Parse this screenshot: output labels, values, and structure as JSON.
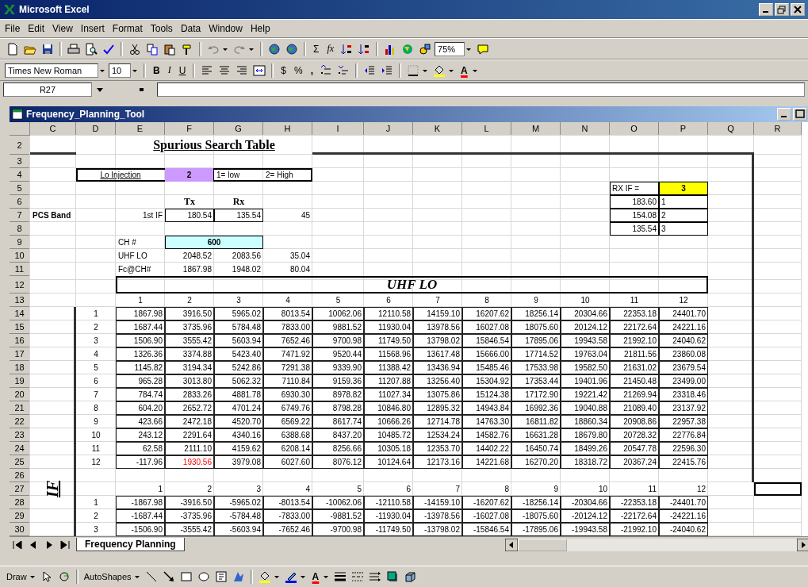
{
  "app": {
    "title": "Microsoft Excel"
  },
  "menu": [
    "File",
    "Edit",
    "View",
    "Insert",
    "Format",
    "Tools",
    "Data",
    "Window",
    "Help"
  ],
  "standard_toolbar": {
    "sum": "Σ",
    "function": "fx",
    "zoom": "75%"
  },
  "formatting_toolbar": {
    "font": "Times New Roman",
    "size": "10",
    "bold": "B",
    "italic": "I",
    "underline": "U",
    "currency": "$",
    "percent": "%",
    "comma": ",",
    "font_color": "A"
  },
  "formula_bar": {
    "name_box": "R27"
  },
  "workbook": {
    "title": "Frequency_Planning_Tool",
    "sheet": {
      "columns": [
        "C",
        "D",
        "E",
        "F",
        "G",
        "H",
        "I",
        "J",
        "K",
        "L",
        "M",
        "N",
        "O",
        "P",
        "Q",
        "R"
      ],
      "rows": [
        "2",
        "3",
        "4",
        "5",
        "6",
        "7",
        "8",
        "9",
        "10",
        "11",
        "12",
        "13",
        "14",
        "15",
        "16",
        "17",
        "18",
        "19",
        "20",
        "21",
        "22",
        "23",
        "24",
        "25",
        "26",
        "27",
        "28",
        "29",
        "30"
      ],
      "title": "Spurious Search Table",
      "lo_injection": {
        "label": "Lo Injection",
        "value": "2",
        "color": "#cc99ff",
        "options": [
          "1= low",
          "2= High"
        ]
      },
      "headers": [
        "Tx",
        "Rx"
      ],
      "band": "PCS Band",
      "params": [
        {
          "label": "1st IF",
          "tx": "180.54",
          "rx": "135.54",
          "diff": "45",
          "boxed": true
        },
        {
          "label": "UHF LO",
          "tx": "2048.52",
          "rx": "2083.56",
          "diff": "35.04",
          "boxed": false
        },
        {
          "label": "Fc@CH#",
          "tx": "1867.98",
          "rx": "1948.02",
          "diff": "80.04",
          "boxed": false
        }
      ],
      "channel": {
        "label": "CH #",
        "value": "600",
        "color": "#ccffff"
      },
      "rx_if": {
        "label": "RX IF =",
        "value": "3",
        "color": "#ffff00",
        "options": [
          {
            "freq": "183.60",
            "n": "1"
          },
          {
            "freq": "154.08",
            "n": "2"
          },
          {
            "freq": "135.54",
            "n": "3"
          }
        ]
      },
      "uhf_table": {
        "title": "UHF LO",
        "headers": [
          "1",
          "2",
          "3",
          "4",
          "5",
          "6",
          "7",
          "8",
          "9",
          "10",
          "11",
          "12"
        ],
        "rows": [
          {
            "n": "1",
            "values": [
              "1867.98",
              "3916.50",
              "5965.02",
              "8013.54",
              "10062.06",
              "12110.58",
              "14159.10",
              "16207.62",
              "18256.14",
              "20304.66",
              "22353.18",
              "24401.70"
            ],
            "flagged": [
              false,
              false,
              false,
              false,
              false,
              false,
              false,
              false,
              false,
              false,
              false,
              false
            ]
          },
          {
            "n": "2",
            "values": [
              "1687.44",
              "3735.96",
              "5784.48",
              "7833.00",
              "9881.52",
              "11930.04",
              "13978.56",
              "16027.08",
              "18075.60",
              "20124.12",
              "22172.64",
              "24221.16"
            ],
            "flagged": [
              false,
              false,
              false,
              false,
              false,
              false,
              false,
              false,
              false,
              false,
              false,
              false
            ]
          },
          {
            "n": "3",
            "values": [
              "1506.90",
              "3555.42",
              "5603.94",
              "7652.46",
              "9700.98",
              "11749.50",
              "13798.02",
              "15846.54",
              "17895.06",
              "19943.58",
              "21992.10",
              "24040.62"
            ],
            "flagged": [
              false,
              false,
              false,
              false,
              false,
              false,
              false,
              false,
              false,
              false,
              false,
              false
            ]
          },
          {
            "n": "4",
            "values": [
              "1326.36",
              "3374.88",
              "5423.40",
              "7471.92",
              "9520.44",
              "11568.96",
              "13617.48",
              "15666.00",
              "17714.52",
              "19763.04",
              "21811.56",
              "23860.08"
            ],
            "flagged": [
              false,
              false,
              false,
              false,
              false,
              false,
              false,
              false,
              false,
              false,
              false,
              false
            ]
          },
          {
            "n": "5",
            "values": [
              "1145.82",
              "3194.34",
              "5242.86",
              "7291.38",
              "9339.90",
              "11388.42",
              "13436.94",
              "15485.46",
              "17533.98",
              "19582.50",
              "21631.02",
              "23679.54"
            ],
            "flagged": [
              false,
              false,
              false,
              false,
              false,
              false,
              false,
              false,
              false,
              false,
              false,
              false
            ]
          },
          {
            "n": "6",
            "values": [
              "965.28",
              "3013.80",
              "5062.32",
              "7110.84",
              "9159.36",
              "11207.88",
              "13256.40",
              "15304.92",
              "17353.44",
              "19401.96",
              "21450.48",
              "23499.00"
            ],
            "flagged": [
              false,
              false,
              false,
              false,
              false,
              false,
              false,
              false,
              false,
              false,
              false,
              false
            ]
          },
          {
            "n": "7",
            "values": [
              "784.74",
              "2833.26",
              "4881.78",
              "6930.30",
              "8978.82",
              "11027.34",
              "13075.86",
              "15124.38",
              "17172.90",
              "19221.42",
              "21269.94",
              "23318.46"
            ],
            "flagged": [
              false,
              false,
              false,
              false,
              false,
              false,
              false,
              false,
              false,
              false,
              false,
              false
            ]
          },
          {
            "n": "8",
            "values": [
              "604.20",
              "2652.72",
              "4701.24",
              "6749.76",
              "8798.28",
              "10846.80",
              "12895.32",
              "14943.84",
              "16992.36",
              "19040.88",
              "21089.40",
              "23137.92"
            ],
            "flagged": [
              false,
              false,
              false,
              false,
              false,
              false,
              false,
              false,
              false,
              false,
              false,
              false
            ]
          },
          {
            "n": "9",
            "values": [
              "423.66",
              "2472.18",
              "4520.70",
              "6569.22",
              "8617.74",
              "10666.26",
              "12714.78",
              "14763.30",
              "16811.82",
              "18860.34",
              "20908.86",
              "22957.38"
            ],
            "flagged": [
              false,
              false,
              false,
              false,
              false,
              false,
              false,
              false,
              false,
              false,
              false,
              false
            ]
          },
          {
            "n": "10",
            "values": [
              "243.12",
              "2291.64",
              "4340.16",
              "6388.68",
              "8437.20",
              "10485.72",
              "12534.24",
              "14582.76",
              "16631.28",
              "18679.80",
              "20728.32",
              "22776.84"
            ],
            "flagged": [
              false,
              false,
              false,
              false,
              false,
              false,
              false,
              false,
              false,
              false,
              false,
              false
            ]
          },
          {
            "n": "11",
            "values": [
              "62.58",
              "2111.10",
              "4159.62",
              "6208.14",
              "8256.66",
              "10305.18",
              "12353.70",
              "14402.22",
              "16450.74",
              "18499.26",
              "20547.78",
              "22596.30"
            ],
            "flagged": [
              false,
              false,
              false,
              false,
              false,
              false,
              false,
              false,
              false,
              false,
              false,
              false
            ]
          },
          {
            "n": "12",
            "values": [
              "-117.96",
              "1930.56",
              "3979.08",
              "6027.60",
              "8076.12",
              "10124.64",
              "12173.16",
              "14221.68",
              "16270.20",
              "18318.72",
              "20367.24",
              "22415.76"
            ],
            "flagged": [
              false,
              true,
              false,
              false,
              false,
              false,
              false,
              false,
              false,
              false,
              false,
              false
            ]
          }
        ]
      },
      "if_table": {
        "title": "IF",
        "headers": [
          "1",
          "2",
          "3",
          "4",
          "5",
          "6",
          "7",
          "8",
          "9",
          "10",
          "11",
          "12"
        ],
        "rows": [
          {
            "n": "1",
            "values": [
              "-1867.98",
              "-3916.50",
              "-5965.02",
              "-8013.54",
              "-10062.06",
              "-12110.58",
              "-14159.10",
              "-16207.62",
              "-18256.14",
              "-20304.66",
              "-22353.18",
              "-24401.70"
            ]
          },
          {
            "n": "2",
            "values": [
              "-1687.44",
              "-3735.96",
              "-5784.48",
              "-7833.00",
              "-9881.52",
              "-11930.04",
              "-13978.56",
              "-16027.08",
              "-18075.60",
              "-20124.12",
              "-22172.64",
              "-24221.16"
            ]
          },
          {
            "n": "3",
            "values": [
              "-1506.90",
              "-3555.42",
              "-5603.94",
              "-7652.46",
              "-9700.98",
              "-11749.50",
              "-13798.02",
              "-15846.54",
              "-17895.06",
              "-19943.58",
              "-21992.10",
              "-24040.62"
            ]
          }
        ]
      }
    },
    "sheet_tabs": [
      {
        "label": "Frequency Planning",
        "selected": true
      }
    ]
  },
  "drawing_toolbar": {
    "draw": "Draw",
    "autoshapes": "AutoShapes",
    "font_color": "A"
  }
}
